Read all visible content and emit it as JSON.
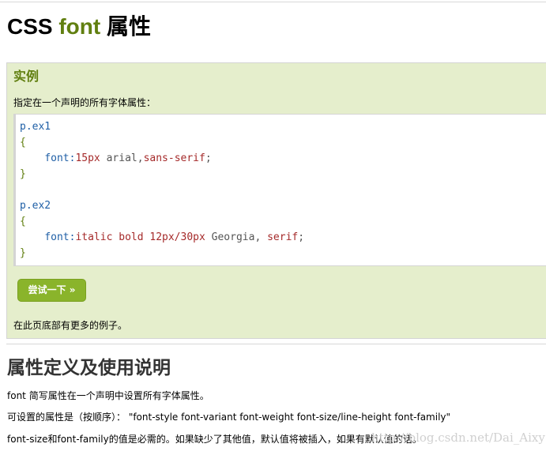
{
  "page": {
    "title_prefix": "CSS ",
    "title_accent": "font",
    "title_suffix": " 属性"
  },
  "example": {
    "heading": "实例",
    "description": "指定在一个声明的所有字体属性：",
    "code": {
      "line1": "p.ex1",
      "line2": "{",
      "line3_prop": "font",
      "line3_colon": ":",
      "line3_size": "15px",
      "line3_family": " arial",
      "line3_comma": ",",
      "line3_generic": "sans-serif",
      "line3_end": ";",
      "line4": "}",
      "line6": "p.ex2",
      "line7": "{",
      "line8_prop": "font",
      "line8_colon": ":",
      "line8_values": "italic bold 12px/30px",
      "line8_family": " Georgia",
      "line8_comma": ", ",
      "line8_generic": "serif",
      "line8_end": ";",
      "line9": "}"
    },
    "try_button": "尝试一下 »",
    "more_text": "在此页底部有更多的例子。"
  },
  "definition": {
    "title": "属性定义及使用说明",
    "p1": "font 简写属性在一个声明中设置所有字体属性。",
    "p2": "可设置的属性是（按顺序）： \"font-style font-variant font-weight font-size/line-height font-family\"",
    "p3": "font-size和font-family的值是必需的。如果缺少了其他值，默认值将被插入，如果有默认值的话。"
  },
  "watermark": "http://blog.csdn.net/Dai_Aixy",
  "colors": {
    "accent": "#617f10",
    "example_bg": "#e5eecc",
    "button": "#8ab42b"
  }
}
